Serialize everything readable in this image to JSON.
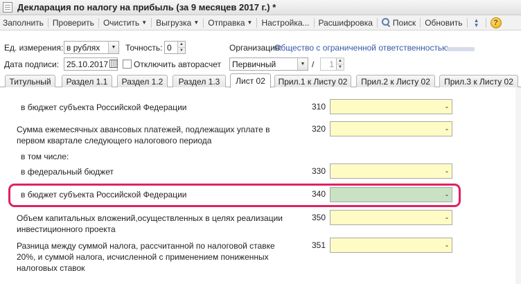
{
  "window": {
    "title": "Декларация по налогу на прибыль (за 9 месяцев 2017 г.) *"
  },
  "toolbar": {
    "fill": "Заполнить",
    "check": "Проверить",
    "clear": "Очистить",
    "export": "Выгрузка",
    "send": "Отправка",
    "settings": "Настройка...",
    "decode": "Расшифровка",
    "search": "Поиск",
    "refresh": "Обновить",
    "help": "?"
  },
  "header": {
    "unit_label": "Ед. измерения:",
    "unit_value": "в рублях",
    "precision_label": "Точность:",
    "precision_value": "0",
    "org_label": "Организация:",
    "org_value": "Общество с ограниченной ответственностью",
    "date_label": "Дата подписи:",
    "date_value": "25.10.2017",
    "autocalc_label": "Отключить авторасчет",
    "autocalc_checked": false,
    "doc_type_value": "Первичный",
    "correction_sep": "/",
    "correction_value": "1"
  },
  "tabs": [
    {
      "label": "Титульный"
    },
    {
      "label": "Раздел 1.1"
    },
    {
      "label": "Раздел 1.2"
    },
    {
      "label": "Раздел 1.3"
    },
    {
      "label": "Лист 02",
      "active": true
    },
    {
      "label": "Прил.1 к Листу 02"
    },
    {
      "label": "Прил.2 к Листу 02"
    },
    {
      "label": "Прил.3 к Листу 02"
    }
  ],
  "rows": {
    "r310": {
      "label": "в бюджет субъекта Российской Федерации",
      "code": "310",
      "value": "-"
    },
    "r320": {
      "label_line1": "Сумма ежемесячных авансовых платежей, подлежащих уплате в",
      "label_line2": "первом квартале следующего налогового периода",
      "code": "320",
      "value": "-"
    },
    "in_total": {
      "label": "в том числе:"
    },
    "r330": {
      "label": "в федеральный бюджет",
      "code": "330",
      "value": "-"
    },
    "r340": {
      "label": "в бюджет субъекта Российской Федерации",
      "code": "340",
      "value": "-"
    },
    "r350": {
      "label_line1": "Объем капитальных вложений,осуществленных в целях реализации",
      "label_line2": "инвестиционного проекта",
      "code": "350",
      "value": "-"
    },
    "r351": {
      "label_line1": "Разница между суммой налога, рассчитанной по налоговой ставке",
      "label_line2": "20%, и суммой налога, исчисленной с применением пониженных",
      "label_line3": "налоговых ставок",
      "code": "351",
      "value": "-"
    }
  },
  "colors": {
    "input_fill": "#fefbc4",
    "selected_fill": "#c9e2c3",
    "highlight": "#e0225e",
    "link": "#3458a8"
  }
}
